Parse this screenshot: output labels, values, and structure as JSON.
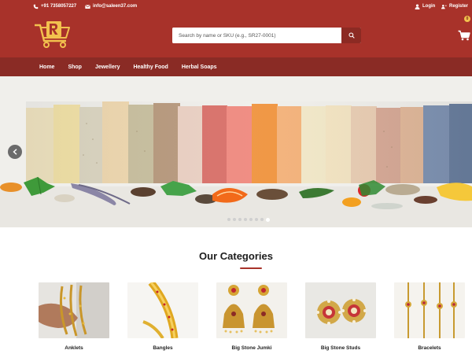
{
  "topbar": {
    "phone": "+91 7358057227",
    "email": "info@saleen37.com",
    "login_label": "Login",
    "register_label": "Register"
  },
  "search": {
    "placeholder": "Search by name or SKU (e.g., SR27-0001)"
  },
  "cart": {
    "count": "0"
  },
  "nav": {
    "items": [
      "Home",
      "Shop",
      "Jewellery",
      "Healthy Food",
      "Herbal Soaps"
    ]
  },
  "slider": {
    "slide_count": 8,
    "active_slide": 8
  },
  "categories": {
    "title": "Our Categories",
    "items": [
      {
        "label": "Anklets"
      },
      {
        "label": "Bangles"
      },
      {
        "label": "Big Stone Jumki"
      },
      {
        "label": "Big Stone Studs"
      },
      {
        "label": "Bracelets"
      }
    ]
  },
  "colors": {
    "brand_red": "#a8322a",
    "nav_red": "#8a2b25",
    "accent_gold": "#f2c14e"
  },
  "icons": {
    "phone": "phone-icon",
    "email": "envelope-icon",
    "login": "user-icon",
    "register": "user-plus-icon",
    "search": "search-icon",
    "cart": "shopping-cart-icon",
    "slider_prev": "chevron-left-icon"
  }
}
